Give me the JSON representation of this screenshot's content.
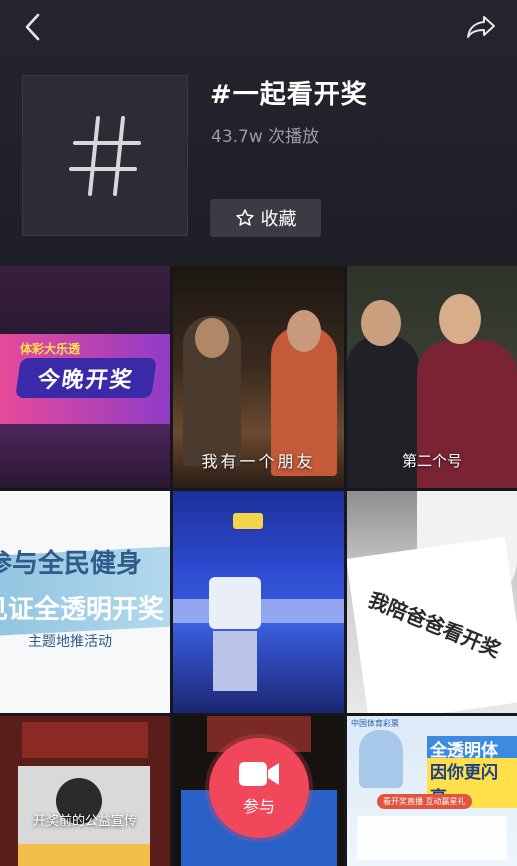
{
  "topic": {
    "title": "#一起看开奖",
    "play_count": "43.7w 次播放",
    "favorite_label": "收藏",
    "cover_symbol": "#"
  },
  "icons": {
    "back": "chevron-left-icon",
    "share": "share-arrow-icon",
    "favorite": "star-outline-icon",
    "join": "video-camera-icon"
  },
  "videos": [
    {
      "banner_text": "今晚开奖",
      "logo_text": "体彩大乐透",
      "caption": ""
    },
    {
      "caption": "我有一个朋友"
    },
    {
      "caption": "第二个号"
    },
    {
      "line1": "参与全民健身",
      "line2": "见证全透明开奖",
      "line3": "主题地推活动",
      "caption": ""
    },
    {
      "caption": ""
    },
    {
      "overlay_text": "我陪爸爸看开奖",
      "caption": ""
    },
    {
      "caption": "开奖前的公益宣传"
    },
    {
      "caption": ""
    },
    {
      "header_text": "中国体育彩票",
      "headline1": "全透明体彩",
      "headline2": "因你更闪亮",
      "sub_button": "看开奖直播 互动赢星礼",
      "caption": ""
    }
  ],
  "join_button": {
    "label": "参与"
  },
  "colors": {
    "header_bg": "#1e1e26",
    "accent": "#f1475a",
    "favorite_bg": "#3b3b44",
    "muted_text": "#9b9ba3"
  }
}
